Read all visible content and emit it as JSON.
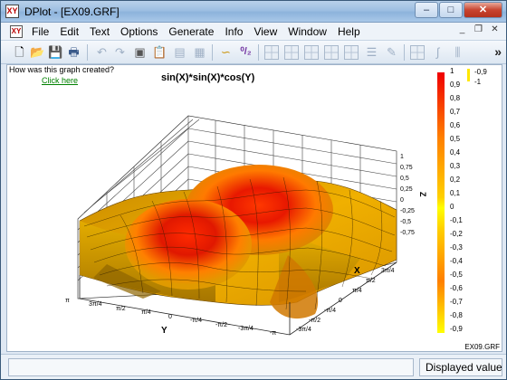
{
  "window": {
    "title": "DPlot - [EX09.GRF]",
    "app_icon_glyph": "XY",
    "minimize_glyph": "–",
    "maximize_glyph": "□",
    "close_glyph": "✕"
  },
  "menu": {
    "items": [
      "File",
      "Edit",
      "Text",
      "Options",
      "Generate",
      "Info",
      "View",
      "Window",
      "Help"
    ],
    "mdi": {
      "minimize": "_",
      "restore": "❐",
      "close": "✕"
    }
  },
  "toolbar": {
    "icons": [
      "new-file-icon",
      "open-folder-icon",
      "save-icon",
      "print-icon",
      "undo-icon",
      "redo-icon",
      "copy-image-icon",
      "paste-icon",
      "clipboard-icon",
      "properties-icon",
      "spline-icon",
      "azimuth-icon"
    ],
    "overflow": "»"
  },
  "client": {
    "help_question": "How was this graph created?",
    "help_link": "Click here",
    "plot_title": "sin(X)*sin(X)*cos(Y)",
    "footer_filename": "EX09.GRF"
  },
  "axes": {
    "z_label": "Z",
    "x_label": "X",
    "y_label": "Y",
    "z_ticks": [
      "1",
      "0,75",
      "0,5",
      "0,25",
      "0",
      "-0,25",
      "-0,5",
      "-0,75"
    ],
    "x_ticks": [
      "-3π/4",
      "-π/2",
      "-π/4",
      "0",
      "π/4",
      "π/2",
      "3π/4"
    ],
    "y_ticks": [
      "π",
      "3π/4",
      "π/2",
      "π/4",
      "0",
      "-π/4",
      "-π/2",
      "-3π/4",
      "-π"
    ]
  },
  "legend": {
    "labels": [
      "1",
      "0,9",
      "0,8",
      "0,7",
      "0,6",
      "0,5",
      "0,4",
      "0,3",
      "0,2",
      "0,1",
      "0",
      "-0,1",
      "-0,2",
      "-0,3",
      "-0,4",
      "-0,5",
      "-0,6",
      "-0,7",
      "-0,8",
      "-0,9"
    ],
    "key_labels": [
      "-0,9",
      "-1"
    ]
  },
  "status": {
    "left": "",
    "right": "Displayed value"
  },
  "colors": {
    "high": "#e00000",
    "mid": "#ff8000",
    "low": "#ffff00"
  }
}
